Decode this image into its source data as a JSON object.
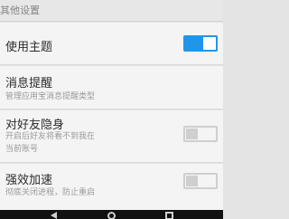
{
  "section": {
    "title": "其他设置"
  },
  "settings": [
    {
      "title": "使用主题",
      "enabled": true
    },
    {
      "title": "消息提醒",
      "subtitle": "管理应用宝消息提醒类型"
    },
    {
      "title": "对好友隐身",
      "subtitle": "开启后好友将看不到我在当前账号",
      "enabled": false
    },
    {
      "title": "强效加速",
      "subtitle": "彻底关闭进程，防止重启",
      "enabled": false
    }
  ],
  "colors": {
    "toggle_on": "#2196e8",
    "toggle_off": "#cfcfcf"
  },
  "navbar": {
    "buttons": [
      "back-icon",
      "home-icon",
      "recent-apps-icon"
    ]
  }
}
